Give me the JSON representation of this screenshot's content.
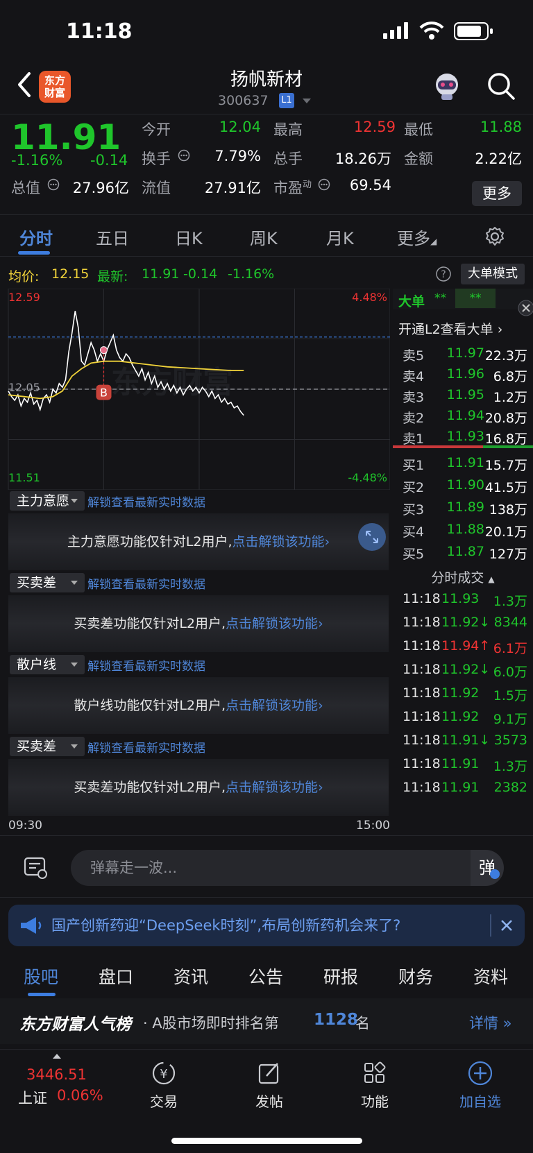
{
  "status": {
    "time": "11:18"
  },
  "header": {
    "app_logo": "东方\n财富",
    "stock_name": "扬帆新材",
    "stock_code": "300637",
    "level_badge": "L1"
  },
  "quote": {
    "price": "11.91",
    "change_pct": "-1.16%",
    "change": "-0.14",
    "fields": [
      {
        "label": "今开",
        "value": "12.04",
        "color": "green"
      },
      {
        "label": "最高",
        "value": "12.59",
        "color": "red"
      },
      {
        "label": "最低",
        "value": "11.88",
        "color": "green"
      },
      {
        "label": "换手",
        "value": "7.79%",
        "color": "white"
      },
      {
        "label": "总手",
        "value": "18.26万",
        "color": "white"
      },
      {
        "label": "金额",
        "value": "2.22亿",
        "color": "white"
      },
      {
        "label": "总值",
        "value": "27.96亿",
        "color": "white"
      },
      {
        "label": "流值",
        "value": "27.91亿",
        "color": "white"
      },
      {
        "label": "市盈",
        "value": "69.54",
        "color": "white"
      }
    ],
    "pe_sup": "动",
    "more_label": "更多"
  },
  "tabs": [
    "分时",
    "五日",
    "日K",
    "周K",
    "月K",
    "更多"
  ],
  "infobar": {
    "avg_label": "均价:",
    "avg_value": "12.15",
    "latest_label": "最新:",
    "latest_value": "11.91",
    "latest_change": "-0.14",
    "latest_pct": "-1.16%",
    "mode_button": "大单模式"
  },
  "chart_data": {
    "type": "line",
    "y_top_label": "12.59",
    "y_mid_label": "12.05",
    "y_bottom_label": "11.51",
    "pct_top_label": "4.48%",
    "pct_bottom_label": "-4.48%",
    "ylim": [
      11.51,
      12.59
    ],
    "xlim": [
      0,
      240
    ],
    "x_start_label": "09:30",
    "x_end_label": "15:00",
    "buy_marker_label": "B",
    "watermark": "东方财富",
    "price_series": [
      [
        0,
        12.04
      ],
      [
        2,
        12.01
      ],
      [
        4,
        11.99
      ],
      [
        6,
        12.02
      ],
      [
        8,
        11.96
      ],
      [
        10,
        12.0
      ],
      [
        12,
        11.98
      ],
      [
        14,
        12.03
      ],
      [
        16,
        11.97
      ],
      [
        18,
        11.99
      ],
      [
        20,
        11.94
      ],
      [
        22,
        12.0
      ],
      [
        24,
        12.02
      ],
      [
        26,
        11.98
      ],
      [
        28,
        12.05
      ],
      [
        30,
        12.03
      ],
      [
        32,
        12.08
      ],
      [
        34,
        12.06
      ],
      [
        36,
        12.1
      ],
      [
        38,
        12.25
      ],
      [
        40,
        12.35
      ],
      [
        42,
        12.47
      ],
      [
        44,
        12.38
      ],
      [
        46,
        12.2
      ],
      [
        48,
        12.18
      ],
      [
        50,
        12.24
      ],
      [
        52,
        12.3
      ],
      [
        54,
        12.26
      ],
      [
        56,
        12.2
      ],
      [
        58,
        12.24
      ],
      [
        60,
        12.2
      ],
      [
        62,
        12.26
      ],
      [
        64,
        12.3
      ],
      [
        66,
        12.34
      ],
      [
        68,
        12.26
      ],
      [
        70,
        12.22
      ],
      [
        72,
        12.2
      ],
      [
        74,
        12.24
      ],
      [
        76,
        12.22
      ],
      [
        78,
        12.18
      ],
      [
        80,
        12.15
      ],
      [
        82,
        12.12
      ],
      [
        84,
        12.16
      ],
      [
        86,
        12.1
      ],
      [
        88,
        12.14
      ],
      [
        90,
        12.08
      ],
      [
        92,
        12.12
      ],
      [
        94,
        12.06
      ],
      [
        96,
        12.09
      ],
      [
        98,
        12.05
      ],
      [
        100,
        12.08
      ],
      [
        102,
        12.04
      ],
      [
        104,
        12.07
      ],
      [
        106,
        12.03
      ],
      [
        108,
        12.06
      ],
      [
        110,
        12.02
      ],
      [
        112,
        12.05
      ],
      [
        114,
        12.07
      ],
      [
        116,
        12.04
      ],
      [
        118,
        12.06
      ],
      [
        120,
        12.03
      ],
      [
        122,
        12.06
      ],
      [
        124,
        12.04
      ],
      [
        126,
        12.01
      ],
      [
        128,
        12.04
      ],
      [
        130,
        12.0
      ],
      [
        132,
        12.02
      ],
      [
        134,
        11.98
      ],
      [
        136,
        12.0
      ],
      [
        138,
        11.97
      ],
      [
        140,
        11.98
      ],
      [
        142,
        11.95
      ],
      [
        144,
        11.96
      ],
      [
        146,
        11.93
      ],
      [
        148,
        11.91
      ]
    ],
    "avg_series": [
      [
        0,
        12.02
      ],
      [
        10,
        12.01
      ],
      [
        20,
        12.0
      ],
      [
        28,
        12.01
      ],
      [
        34,
        12.04
      ],
      [
        40,
        12.12
      ],
      [
        46,
        12.16
      ],
      [
        52,
        12.19
      ],
      [
        60,
        12.2
      ],
      [
        70,
        12.2
      ],
      [
        80,
        12.19
      ],
      [
        90,
        12.18
      ],
      [
        100,
        12.17
      ],
      [
        110,
        12.165
      ],
      [
        120,
        12.16
      ],
      [
        130,
        12.155
      ],
      [
        140,
        12.15
      ],
      [
        148,
        12.15
      ]
    ],
    "buy_marker": {
      "x": 60,
      "y": 12.26
    }
  },
  "panels": [
    {
      "name": "主力意愿",
      "link": "解锁查看最新实时数据",
      "msg": "主力意愿功能仅针对L2用户,",
      "cta": "点击解锁该功能"
    },
    {
      "name": "买卖差",
      "link": "解锁查看最新实时数据",
      "msg": "买卖差功能仅针对L2用户,",
      "cta": "点击解锁该功能"
    },
    {
      "name": "散户线",
      "link": "解锁查看最新实时数据",
      "msg": "散户线功能仅针对L2用户,",
      "cta": "点击解锁该功能"
    },
    {
      "name": "买卖差",
      "link": "解锁查看最新实时数据",
      "msg": "买卖差功能仅针对L2用户,",
      "cta": "点击解锁该功能"
    }
  ],
  "side": {
    "bigorder_label": "大单",
    "bigorder_v1": "**",
    "bigorder_v2": "**",
    "l2_prompt": "开通L2查看大单 ›",
    "asks": [
      {
        "label": "卖5",
        "price": "11.97",
        "vol": "22.3万"
      },
      {
        "label": "卖4",
        "price": "11.96",
        "vol": "6.8万"
      },
      {
        "label": "卖3",
        "price": "11.95",
        "vol": "1.2万"
      },
      {
        "label": "卖2",
        "price": "11.94",
        "vol": "20.8万"
      },
      {
        "label": "卖1",
        "price": "11.93",
        "vol": "16.8万"
      }
    ],
    "bids": [
      {
        "label": "买1",
        "price": "11.91",
        "vol": "15.7万"
      },
      {
        "label": "买2",
        "price": "11.90",
        "vol": "41.5万"
      },
      {
        "label": "买3",
        "price": "11.89",
        "vol": "138万"
      },
      {
        "label": "买4",
        "price": "11.88",
        "vol": "20.1万"
      },
      {
        "label": "买5",
        "price": "11.87",
        "vol": "127万"
      }
    ],
    "trades_title": "分时成交",
    "trades": [
      {
        "t": "11:18",
        "p": "11.93",
        "v": "1.3万",
        "dir": "",
        "vc": "green"
      },
      {
        "t": "11:18",
        "p": "11.92↓",
        "v": "8344",
        "dir": "down",
        "vc": "green"
      },
      {
        "t": "11:18",
        "p": "11.94",
        "v": "6.1万",
        "dir": "up",
        "vc": "red"
      },
      {
        "t": "11:18",
        "p": "11.92↓",
        "v": "6.0万",
        "dir": "down",
        "vc": "green"
      },
      {
        "t": "11:18",
        "p": "11.92",
        "v": "1.5万",
        "dir": "",
        "vc": "green"
      },
      {
        "t": "11:18",
        "p": "11.92",
        "v": "9.1万",
        "dir": "",
        "vc": "green"
      },
      {
        "t": "11:18",
        "p": "11.91↓",
        "v": "3573",
        "dir": "down",
        "vc": "green"
      },
      {
        "t": "11:18",
        "p": "11.91",
        "v": "1.3万",
        "dir": "",
        "vc": "green"
      },
      {
        "t": "11:18",
        "p": "11.91",
        "v": "2382",
        "dir": "",
        "vc": "green"
      }
    ]
  },
  "danmu": {
    "placeholder": "弹幕走一波...",
    "send_glyph": "弹"
  },
  "news": {
    "text": "国产创新药迎“DeepSeek时刻”,布局创新药机会来了?"
  },
  "bottom_tabs": [
    "股吧",
    "盘口",
    "资讯",
    "公告",
    "研报",
    "财务",
    "资料"
  ],
  "rank": {
    "title": "东方财富人气榜",
    "prefix": "· A股市场即时排名第",
    "rank": "1128",
    "suffix": "名",
    "detail": "详情"
  },
  "nav": {
    "index_value": "3446.51",
    "index_name": "上证",
    "index_pct": "0.06%",
    "items": [
      "交易",
      "发帖",
      "功能",
      "加自选"
    ],
    "trade_glyph": "¥"
  },
  "colors": {
    "green": "#1fc52b",
    "red": "#ee3333",
    "accent": "#3d7de0",
    "avg_line": "#f1d33a"
  }
}
